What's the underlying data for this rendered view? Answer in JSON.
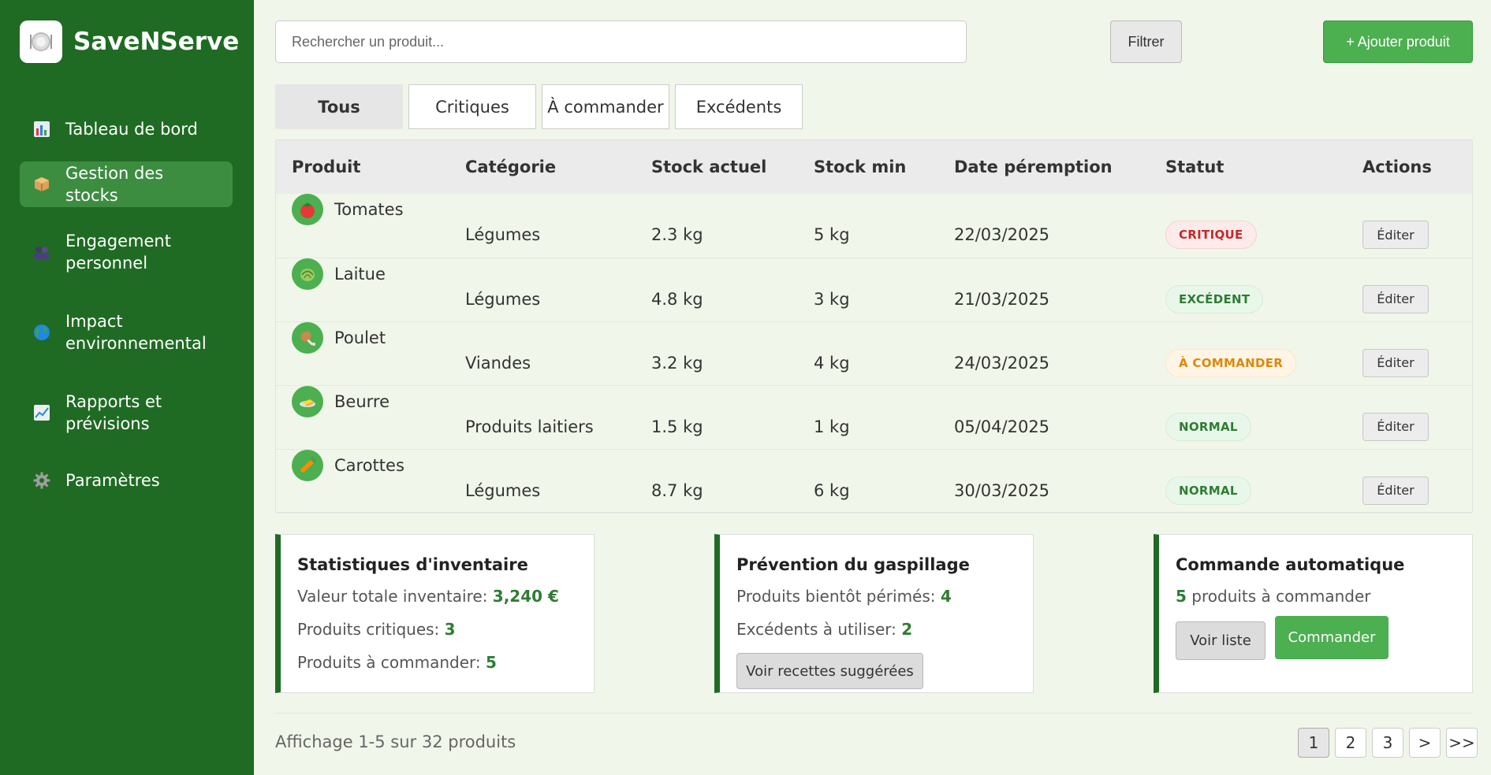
{
  "app": {
    "name": "SaveNServe"
  },
  "sidebar": {
    "items": [
      {
        "label": "Tableau de bord",
        "icon": "bar-chart-icon"
      },
      {
        "label": "Gestion des stocks",
        "icon": "package-icon",
        "active": true
      },
      {
        "label": "Engagement personnel",
        "icon": "team-icon"
      },
      {
        "label": "Impact environnemental",
        "icon": "globe-icon"
      },
      {
        "label": "Rapports et prévisions",
        "icon": "trend-chart-icon"
      },
      {
        "label": "Paramètres",
        "icon": "gear-icon"
      }
    ]
  },
  "toolbar": {
    "search_placeholder": "Rechercher un produit...",
    "filter_label": "Filtrer",
    "add_label": "+ Ajouter produit"
  },
  "tabs": [
    {
      "label": "Tous",
      "active": true
    },
    {
      "label": "Critiques"
    },
    {
      "label": "À commander"
    },
    {
      "label": "Excédents"
    }
  ],
  "table": {
    "headers": [
      "Produit",
      "Catégorie",
      "Stock actuel",
      "Stock min",
      "Date péremption",
      "Statut",
      "Actions"
    ],
    "rows": [
      {
        "name": "Tomates",
        "icon": "tomato-icon",
        "category": "Légumes",
        "stock": "2.3 kg",
        "min": "5 kg",
        "date": "22/03/2025",
        "status": "CRITIQUE",
        "action": "Éditer"
      },
      {
        "name": "Laitue",
        "icon": "lettuce-icon",
        "category": "Légumes",
        "stock": "4.8 kg",
        "min": "3 kg",
        "date": "21/03/2025",
        "status": "EXCÉDENT",
        "action": "Éditer"
      },
      {
        "name": "Poulet",
        "icon": "chicken-icon",
        "category": "Viandes",
        "stock": "3.2 kg",
        "min": "4 kg",
        "date": "24/03/2025",
        "status": "À COMMANDER",
        "action": "Éditer"
      },
      {
        "name": "Beurre",
        "icon": "butter-icon",
        "category": "Produits laitiers",
        "stock": "1.5 kg",
        "min": "1 kg",
        "date": "05/04/2025",
        "status": "NORMAL",
        "action": "Éditer"
      },
      {
        "name": "Carottes",
        "icon": "carrot-icon",
        "category": "Légumes",
        "stock": "8.7 kg",
        "min": "6 kg",
        "date": "30/03/2025",
        "status": "NORMAL",
        "action": "Éditer"
      }
    ]
  },
  "cards": {
    "inventory": {
      "title": "Statistiques d'inventaire",
      "value_label": "Valeur totale inventaire: ",
      "value": "3,240 €",
      "critical_label": "Produits critiques: ",
      "critical": "3",
      "order_label": "Produits à commander: ",
      "order": "5"
    },
    "waste": {
      "title": "Prévention du gaspillage",
      "expiring_label": "Produits bientôt périmés: ",
      "expiring": "4",
      "surplus_label": "Excédents à utiliser: ",
      "surplus": "2",
      "button": "Voir recettes suggérées"
    },
    "auto_order": {
      "title": "Commande automatique",
      "count": "5",
      "count_label": " produits à commander",
      "list_button": "Voir liste",
      "order_button": "Commander"
    }
  },
  "footer": {
    "showing": "Affichage 1-5 sur 32 produits",
    "pages": [
      "1",
      "2",
      "3",
      ">",
      ">>"
    ],
    "current_page": "1"
  },
  "colors": {
    "sidebar": "#1f6b23",
    "active_nav": "#3c8d40",
    "accent": "#4caf50",
    "critique": "#c62828",
    "commander": "#d98a0c",
    "normal": "#2e7d32"
  }
}
